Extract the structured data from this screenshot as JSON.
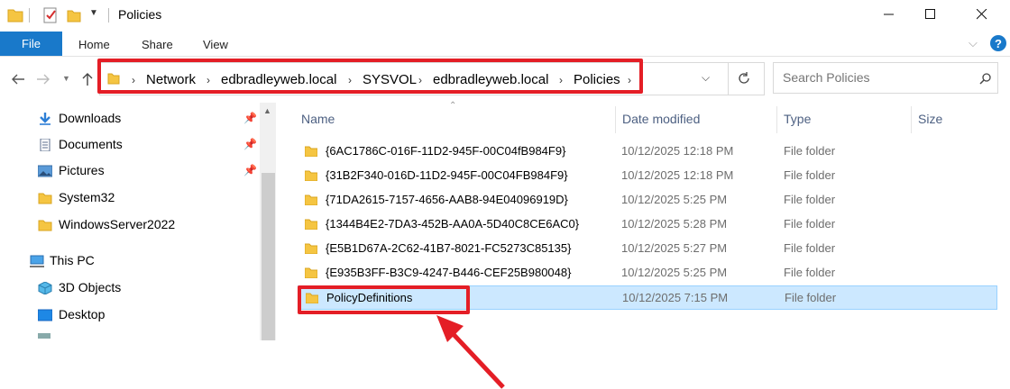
{
  "window": {
    "title": "Policies"
  },
  "ribbon": {
    "tabs": [
      "File",
      "Home",
      "Share",
      "View"
    ]
  },
  "address": {
    "crumbs": [
      "Network",
      "edbradleyweb.local",
      "SYSVOL",
      "edbradleyweb.local",
      "Policies"
    ]
  },
  "search": {
    "placeholder": "Search Policies"
  },
  "sidebar": {
    "items": [
      {
        "label": "Downloads",
        "icon": "download-arrow-icon",
        "pinned": true
      },
      {
        "label": "Documents",
        "icon": "documents-icon",
        "pinned": true
      },
      {
        "label": "Pictures",
        "icon": "pictures-icon",
        "pinned": true
      },
      {
        "label": "System32",
        "icon": "folder-icon",
        "pinned": false
      },
      {
        "label": "WindowsServer2022",
        "icon": "folder-icon",
        "pinned": false
      },
      {
        "label": "This PC",
        "icon": "computer-icon",
        "pinned": false
      },
      {
        "label": "3D Objects",
        "icon": "cube-icon",
        "pinned": false
      },
      {
        "label": "Desktop",
        "icon": "desktop-icon",
        "pinned": false
      }
    ]
  },
  "columns": {
    "name": "Name",
    "date": "Date modified",
    "type": "Type",
    "size": "Size"
  },
  "files": [
    {
      "name": "{6AC1786C-016F-11D2-945F-00C04fB984F9}",
      "date": "10/12/2025 12:18 PM",
      "type": "File folder"
    },
    {
      "name": "{31B2F340-016D-11D2-945F-00C04FB984F9}",
      "date": "10/12/2025 12:18 PM",
      "type": "File folder"
    },
    {
      "name": "{71DA2615-7157-4656-AAB8-94E04096919D}",
      "date": "10/12/2025 5:25 PM",
      "type": "File folder"
    },
    {
      "name": "{1344B4E2-7DA3-452B-AA0A-5D40C8CE6AC0}",
      "date": "10/12/2025 5:28 PM",
      "type": "File folder"
    },
    {
      "name": "{E5B1D67A-2C62-41B7-8021-FC5273C85135}",
      "date": "10/12/2025 5:27 PM",
      "type": "File folder"
    },
    {
      "name": "{E935B3FF-B3C9-4247-B446-CEF25B980048}",
      "date": "10/12/2025 5:25 PM",
      "type": "File folder"
    },
    {
      "name": "PolicyDefinitions",
      "date": "10/12/2025 7:15 PM",
      "type": "File folder",
      "selected": true
    }
  ],
  "colors": {
    "accent": "#1979ca",
    "highlight": "#e41e26",
    "selection": "#cce8ff",
    "folder": "#f5c542"
  }
}
